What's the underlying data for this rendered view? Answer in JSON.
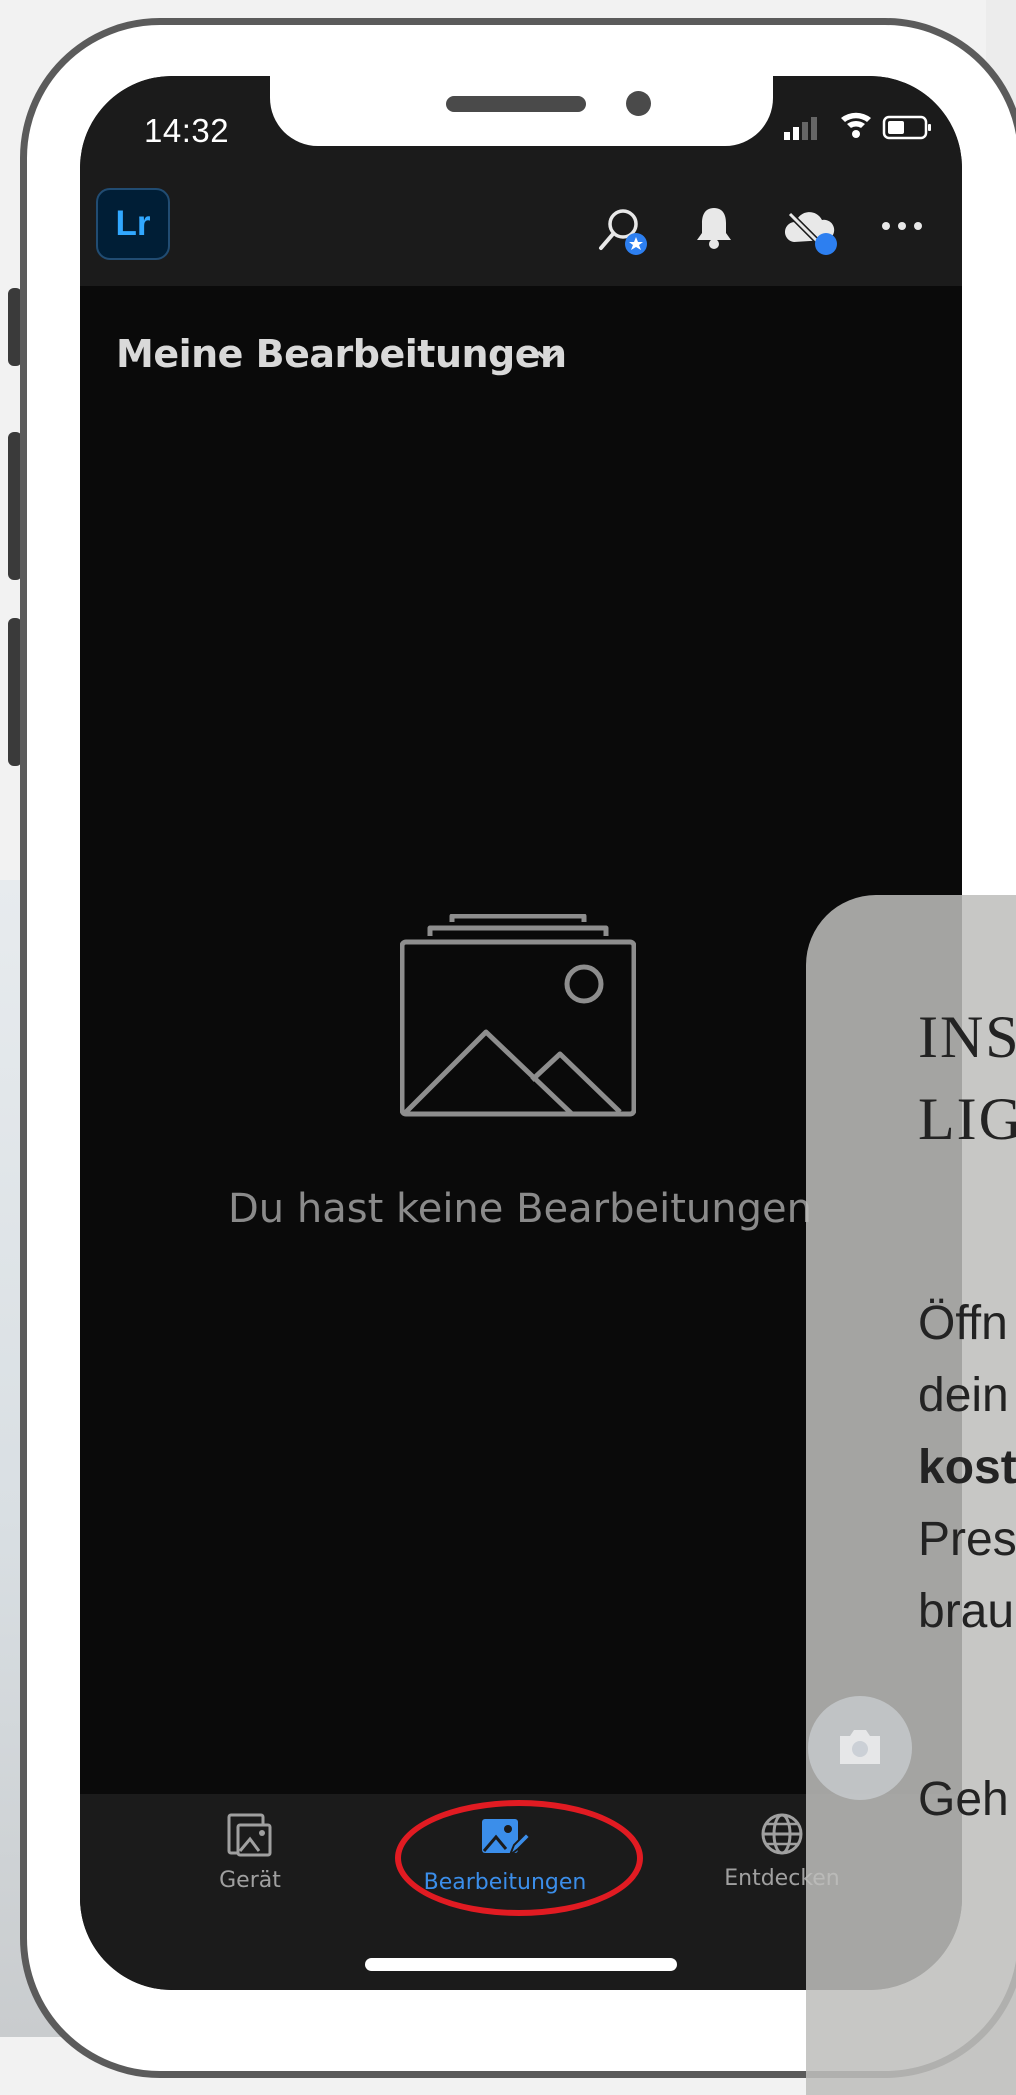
{
  "status_bar": {
    "time": "14:32"
  },
  "header": {
    "app_logo": "Lr",
    "icons": [
      "search-star-icon",
      "bell-icon",
      "cloud-sync-icon",
      "more-icon"
    ]
  },
  "content": {
    "title": "Meine Bearbeitungen",
    "empty_message": "Du hast keine Bearbeitungen"
  },
  "tabs": [
    {
      "label": "Gerät",
      "icon": "device-photos-icon",
      "active": false
    },
    {
      "label": "Bearbeitungen",
      "icon": "edits-icon",
      "active": true
    },
    {
      "label": "Entdecken",
      "icon": "globe-icon",
      "active": false
    }
  ],
  "overlay": {
    "heading_line1": "INS",
    "heading_line2": "LIG",
    "body_line1": "Öffn",
    "body_line2": "dein",
    "body_line3_bold": "kost",
    "body_line4": "Pres",
    "body_line5": "brau",
    "last_line": "Geh"
  },
  "colors": {
    "accent": "#3b8eea",
    "highlight_ring": "#e11b22",
    "lr_brand": "#31a8ff",
    "screen_bg": "#0a0a0a"
  }
}
